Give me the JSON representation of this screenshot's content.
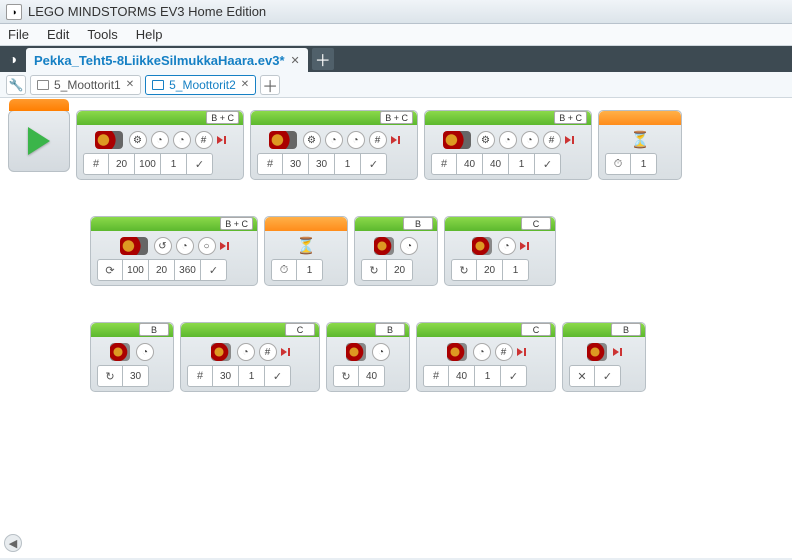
{
  "window": {
    "title": "LEGO MINDSTORMS EV3 Home Edition"
  },
  "menu": {
    "file": "File",
    "edit": "Edit",
    "tools": "Tools",
    "help": "Help"
  },
  "project_tab": {
    "name": "Pekka_Teht5-8LiikkeSilmukkaHaara.ev3*"
  },
  "program_tabs": [
    {
      "name": "5_Moottorit1",
      "active": false
    },
    {
      "name": "5_Moottorit2",
      "active": true
    }
  ],
  "rows": [
    {
      "start": true,
      "blocks": [
        {
          "type": "tank",
          "hdr": "green",
          "port": "B + C",
          "icons": [
            "tune",
            "dial",
            "dial",
            "hash",
            "play"
          ],
          "params": [
            {
              "sym": "#"
            },
            {
              "v": "20"
            },
            {
              "v": "100"
            },
            {
              "v": "1"
            },
            {
              "sym": "✓"
            }
          ]
        },
        {
          "type": "tank",
          "hdr": "green",
          "port": "B + C",
          "icons": [
            "tune",
            "dial",
            "dial",
            "hash",
            "play"
          ],
          "params": [
            {
              "sym": "#"
            },
            {
              "v": "30"
            },
            {
              "v": "30"
            },
            {
              "v": "1"
            },
            {
              "sym": "✓"
            }
          ]
        },
        {
          "type": "tank",
          "hdr": "green",
          "port": "B + C",
          "icons": [
            "tune",
            "dial",
            "dial",
            "hash",
            "play"
          ],
          "params": [
            {
              "sym": "#"
            },
            {
              "v": "40"
            },
            {
              "v": "40"
            },
            {
              "v": "1"
            },
            {
              "sym": "✓"
            }
          ]
        },
        {
          "type": "wait",
          "hdr": "orange",
          "params": [
            {
              "sym": "⏱"
            },
            {
              "v": "1"
            }
          ]
        }
      ]
    },
    {
      "blocks": [
        {
          "type": "steer",
          "hdr": "green",
          "port": "B + C",
          "icons": [
            "steer",
            "dial",
            "circ",
            "play"
          ],
          "params": [
            {
              "sym": "⟳"
            },
            {
              "v": "100"
            },
            {
              "v": "20"
            },
            {
              "v": "360"
            },
            {
              "sym": "✓"
            }
          ]
        },
        {
          "type": "wait",
          "hdr": "orange",
          "params": [
            {
              "sym": "⏱"
            },
            {
              "v": "1"
            }
          ]
        },
        {
          "type": "motor",
          "hdr": "green",
          "port": "B",
          "icons": [
            "dial"
          ],
          "params": [
            {
              "sym": "↻"
            },
            {
              "v": "20"
            }
          ]
        },
        {
          "type": "motor",
          "hdr": "green",
          "port": "C",
          "icons": [
            "dial",
            "play"
          ],
          "params": [
            {
              "sym": "↻"
            },
            {
              "v": "20"
            },
            {
              "v": "1"
            }
          ]
        }
      ]
    },
    {
      "blocks": [
        {
          "type": "motor",
          "hdr": "green",
          "port": "B",
          "icons": [
            "dial"
          ],
          "params": [
            {
              "sym": "↻"
            },
            {
              "v": "30"
            }
          ]
        },
        {
          "type": "motor",
          "hdr": "green",
          "port": "C",
          "icons": [
            "dial",
            "hash",
            "play"
          ],
          "params": [
            {
              "sym": "#"
            },
            {
              "v": "30"
            },
            {
              "v": "1"
            },
            {
              "sym": "✓"
            }
          ]
        },
        {
          "type": "motor",
          "hdr": "green",
          "port": "B",
          "icons": [
            "dial"
          ],
          "params": [
            {
              "sym": "↻"
            },
            {
              "v": "40"
            }
          ]
        },
        {
          "type": "motor",
          "hdr": "green",
          "port": "C",
          "icons": [
            "dial",
            "hash",
            "play"
          ],
          "params": [
            {
              "sym": "#"
            },
            {
              "v": "40"
            },
            {
              "v": "1"
            },
            {
              "sym": "✓"
            }
          ]
        },
        {
          "type": "motor",
          "hdr": "green",
          "port": "B",
          "icons": [
            "play"
          ],
          "params": [
            {
              "sym": "✕"
            },
            {
              "sym": "✓"
            }
          ]
        }
      ]
    }
  ]
}
